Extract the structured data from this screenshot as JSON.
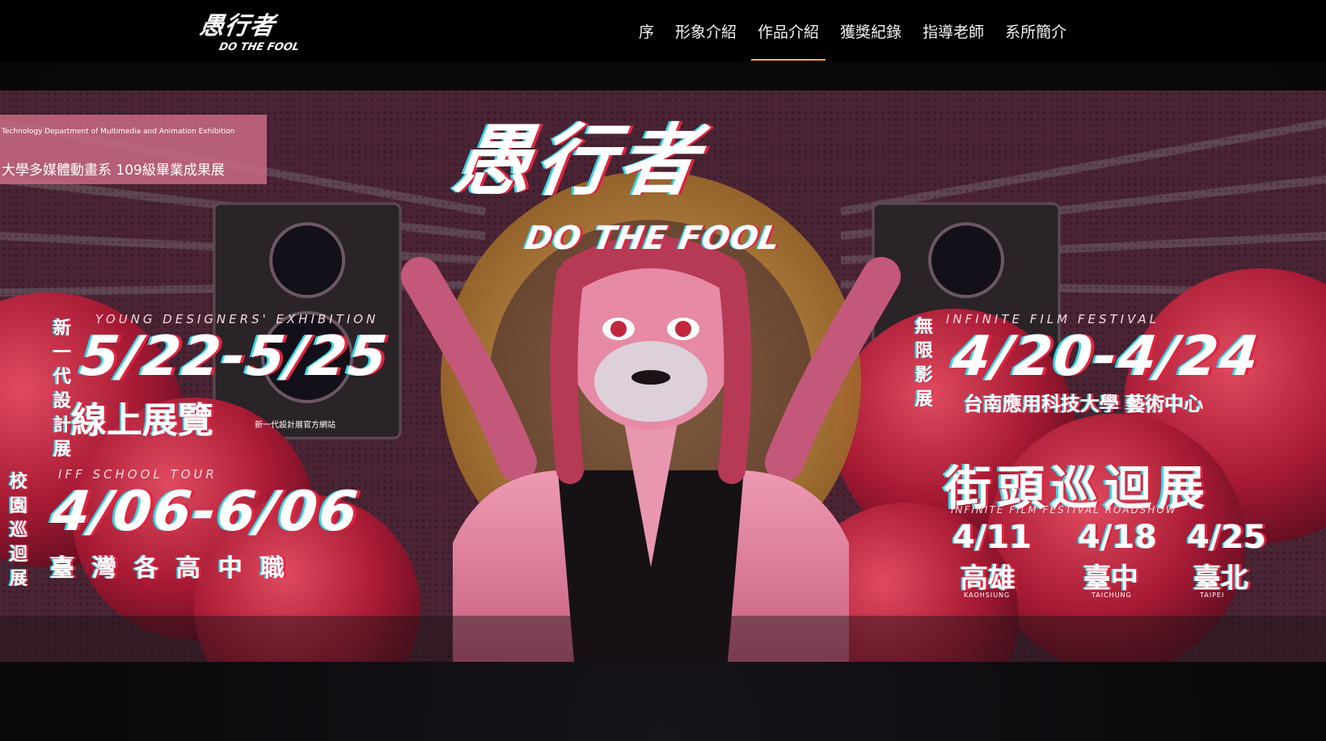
{
  "header": {
    "logo_zh": "愚行者",
    "logo_en": "DO THE FOOL",
    "nav": [
      {
        "label": "序"
      },
      {
        "label": "形象介紹"
      },
      {
        "label": "作品介紹"
      },
      {
        "label": "獲獎紀錄"
      },
      {
        "label": "指導老師"
      },
      {
        "label": "系所簡介"
      }
    ],
    "active_index": 2,
    "active_color": "#e9b341"
  },
  "banner": {
    "dept_en": "Technology Department of Multimedia and Animation Exhibition",
    "dept_zh": "大學多媒體動畫系 109級畢業成果展",
    "title_zh": "愚行者",
    "title_en": "DO THE FOOL",
    "left_top": {
      "vertical_label": "新一代設計展",
      "en_label": "YOUNG DESIGNERS' EXHIBITION",
      "dates": "5/22-5/25",
      "subtitle": "線上展覽",
      "note": "新一代設計展官方網站"
    },
    "left_bottom": {
      "vertical_label": "校園巡迴展",
      "en_label": "IFF SCHOOL TOUR",
      "dates": "4/06-6/06",
      "subtitle": "臺灣各高中職"
    },
    "right_top": {
      "vertical_label": "無限影展",
      "en_label": "INFINITE FILM FESTIVAL",
      "dates": "4/20-4/24",
      "subtitle": "台南應用科技大學 藝術中心"
    },
    "right_bottom": {
      "title": "街頭巡迴展",
      "en_label": "INFINITE FILM FESTIVAL ROADSHOW",
      "stops": [
        {
          "date": "4/11",
          "city": "高雄",
          "city_en": "KAOHSIUNG"
        },
        {
          "date": "4/18",
          "city": "臺中",
          "city_en": "TAICHUNG"
        },
        {
          "date": "4/25",
          "city": "臺北",
          "city_en": "TAIPEI"
        }
      ]
    },
    "colors": {
      "crimson": "#c22a47",
      "magenta": "#e0243e",
      "cyan": "#37d7e8",
      "gold": "#d9a441",
      "skin": "#e68aa5"
    }
  }
}
